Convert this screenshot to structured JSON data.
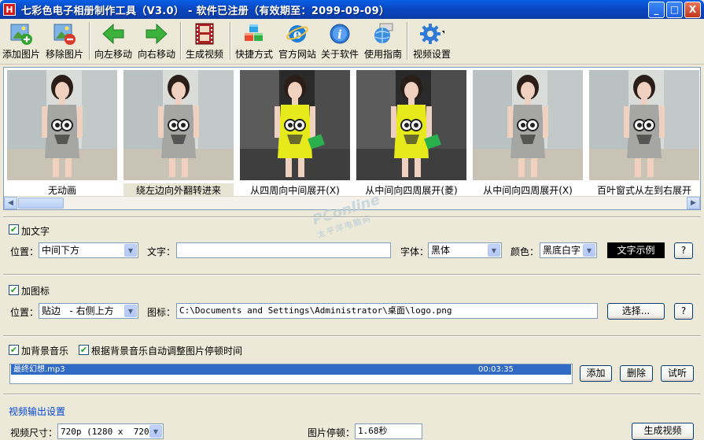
{
  "window": {
    "title": "七彩色电子相册制作工具（V3.0） - 软件已注册（有效期至：2099-09-09）",
    "app_icon_glyph": "H",
    "min_glyph": "_",
    "max_glyph": "□",
    "close_glyph": "X"
  },
  "toolbar": {
    "add_image": "添加图片",
    "remove_image": "移除图片",
    "move_left": "向左移动",
    "move_right": "向右移动",
    "generate_video": "生成视频",
    "shortcut": "快捷方式",
    "website": "官方网站",
    "about": "关于软件",
    "guide": "使用指南",
    "video_settings": "视频设置"
  },
  "thumbnails": [
    {
      "caption": "无动画",
      "dress": "gray",
      "selected": false
    },
    {
      "caption": "绕左边向外翻转进来",
      "dress": "gray",
      "selected": true
    },
    {
      "caption": "从四周向中间展开(X)",
      "dress": "yellow",
      "selected": false
    },
    {
      "caption": "从中间向四周展开(菱)",
      "dress": "yellow",
      "selected": false
    },
    {
      "caption": "从中间向四周展开(X)",
      "dress": "gray",
      "selected": false
    },
    {
      "caption": "百叶窗式从左到右展开",
      "dress": "gray",
      "selected": false
    }
  ],
  "text_section": {
    "enabled_label": "加文字",
    "position_label": "位置：",
    "position_value": "中间下方",
    "text_label": "文字：",
    "text_value": "",
    "font_label": "字体：",
    "font_value": "黑体",
    "color_label": "颜色：",
    "color_value": "黑底白字",
    "sample_button": "文字示例",
    "help_button": "?"
  },
  "logo_section": {
    "enabled_label": "加图标",
    "position_label": "位置：",
    "position_value": "贴边   - 右侧上方",
    "icon_label": "图标：",
    "icon_path": "C:\\Documents and Settings\\Administrator\\桌面\\logo.png",
    "choose_button": "选择...",
    "help_button": "?"
  },
  "music_section": {
    "enabled_label": "加背景音乐",
    "auto_adjust_label": "根据背景音乐自动调整图片停顿时间",
    "tracks": [
      {
        "name": "最终幻想.mp3",
        "duration": "00:03:35"
      }
    ],
    "add_button": "添加",
    "delete_button": "删除",
    "listen_button": "试听"
  },
  "output_section": {
    "title": "视频输出设置",
    "size_label": "视频尺寸：",
    "size_value": "720p (1280 x  720)",
    "pause_label": "图片停顿：",
    "pause_value": "1.68秒",
    "generate_button": "生成视频"
  },
  "watermark": {
    "line1": "PConline",
    "line2": "太平洋电脑网"
  },
  "colors": {
    "titlebar": "#0a5fe6",
    "dialog_bg": "#ece9d8",
    "selection": "#316ac5",
    "section_title": "#0046d5",
    "yellow_dress": "#e6ea1a",
    "gray_dress": "#a6a7a4"
  }
}
